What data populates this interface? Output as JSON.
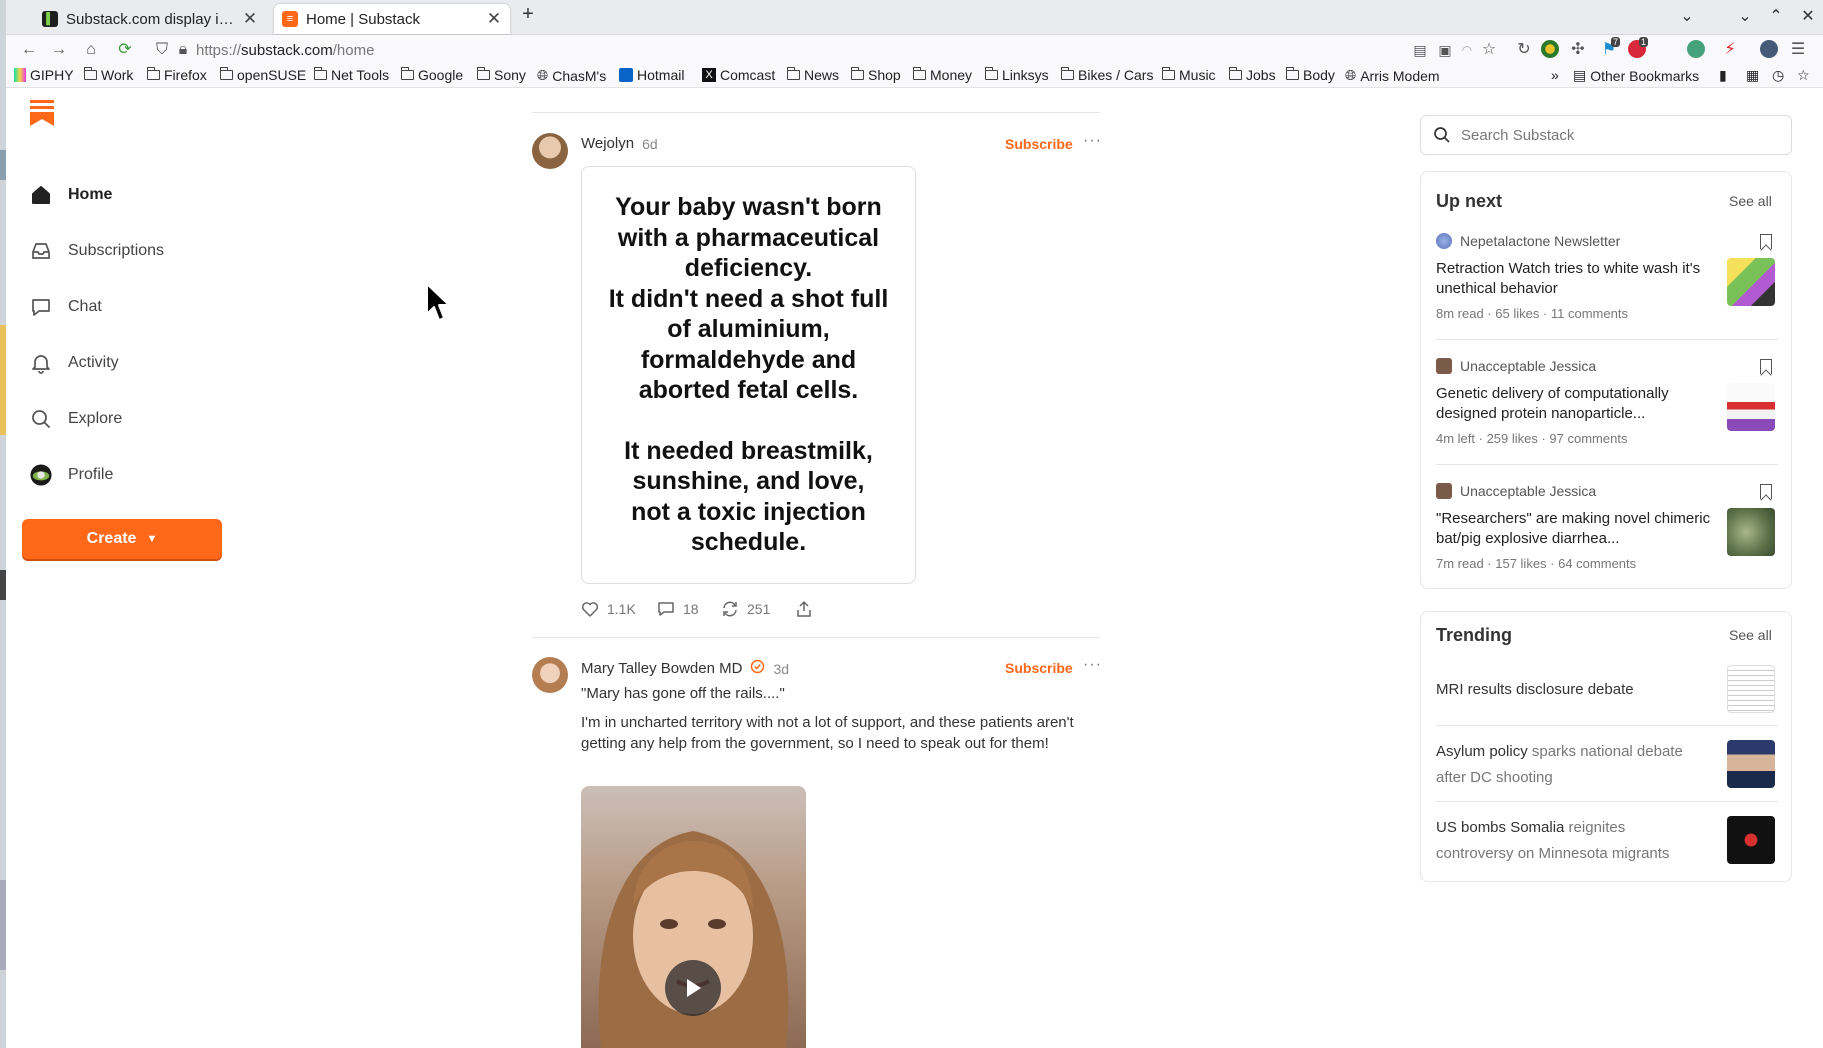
{
  "browser": {
    "tabs": [
      {
        "title": "Substack.com display issue",
        "active": false
      },
      {
        "title": "Home | Substack",
        "active": true
      }
    ],
    "url": {
      "proto": "https://",
      "host": "substack.com",
      "path": "/home"
    },
    "bookmarks": [
      "GIPHY",
      "Work",
      "Firefox",
      "openSUSE",
      "Net Tools",
      "Google",
      "Sony",
      "ChasM's",
      "Hotmail",
      "Comcast",
      "News",
      "Shop",
      "Money",
      "Linksys",
      "Bikes / Cars",
      "Music",
      "Jobs",
      "Body",
      "Arris Modem"
    ],
    "other_bookmarks": "Other Bookmarks",
    "ext_badges": {
      "b1": "7",
      "b2": "1"
    }
  },
  "sidebar": {
    "items": [
      {
        "label": "Home"
      },
      {
        "label": "Subscriptions"
      },
      {
        "label": "Chat"
      },
      {
        "label": "Activity"
      },
      {
        "label": "Explore"
      },
      {
        "label": "Profile"
      }
    ],
    "create_label": "Create"
  },
  "feed": {
    "posts": [
      {
        "author": "Wejolyn",
        "age": "6d",
        "subscribe": "Subscribe",
        "meme_lines_1": [
          "Your baby wasn't born",
          "with a pharmaceutical",
          "deficiency.",
          "It didn't need a shot full",
          "of aluminium,",
          "formaldehyde and",
          "aborted fetal cells."
        ],
        "meme_lines_2": [
          "It needed breastmilk,",
          "sunshine, and love,",
          "not a toxic injection",
          "schedule."
        ],
        "likes": "1.1K",
        "comments": "18",
        "restacks": "251"
      },
      {
        "author": "Mary Talley Bowden MD",
        "age": "3d",
        "subscribe": "Subscribe",
        "quote": "\"Mary has gone off the rails....\"",
        "body": "I'm in uncharted territory with not a lot of support, and these patients aren't getting any help from the government, so I need to speak out for them!"
      }
    ]
  },
  "right": {
    "search_placeholder": "Search Substack",
    "up_next": {
      "title": "Up next",
      "see_all": "See all",
      "items": [
        {
          "pub": "Nepetalactone Newsletter",
          "title": "Retraction Watch tries to white wash it's unethical behavior",
          "meta": "8m read · 65 likes · 11 comments"
        },
        {
          "pub": "Unacceptable Jessica",
          "title": "Genetic delivery of computationally designed protein nanoparticle...",
          "meta": "4m left · 259 likes · 97 comments"
        },
        {
          "pub": "Unacceptable Jessica",
          "title": "\"Researchers\" are making novel chimeric bat/pig explosive diarrhea...",
          "meta": "7m read · 157 likes · 64 comments"
        }
      ]
    },
    "trending": {
      "title": "Trending",
      "see_all": "See all",
      "items": [
        {
          "bold": "MRI results disclosure debate",
          "rest": ""
        },
        {
          "bold": "Asylum policy",
          "rest": " sparks national debate after DC shooting"
        },
        {
          "bold": "US bombs Somalia",
          "rest": " reignites controversy on Minnesota migrants"
        }
      ]
    }
  },
  "colors": {
    "accent": "#ff6719"
  }
}
